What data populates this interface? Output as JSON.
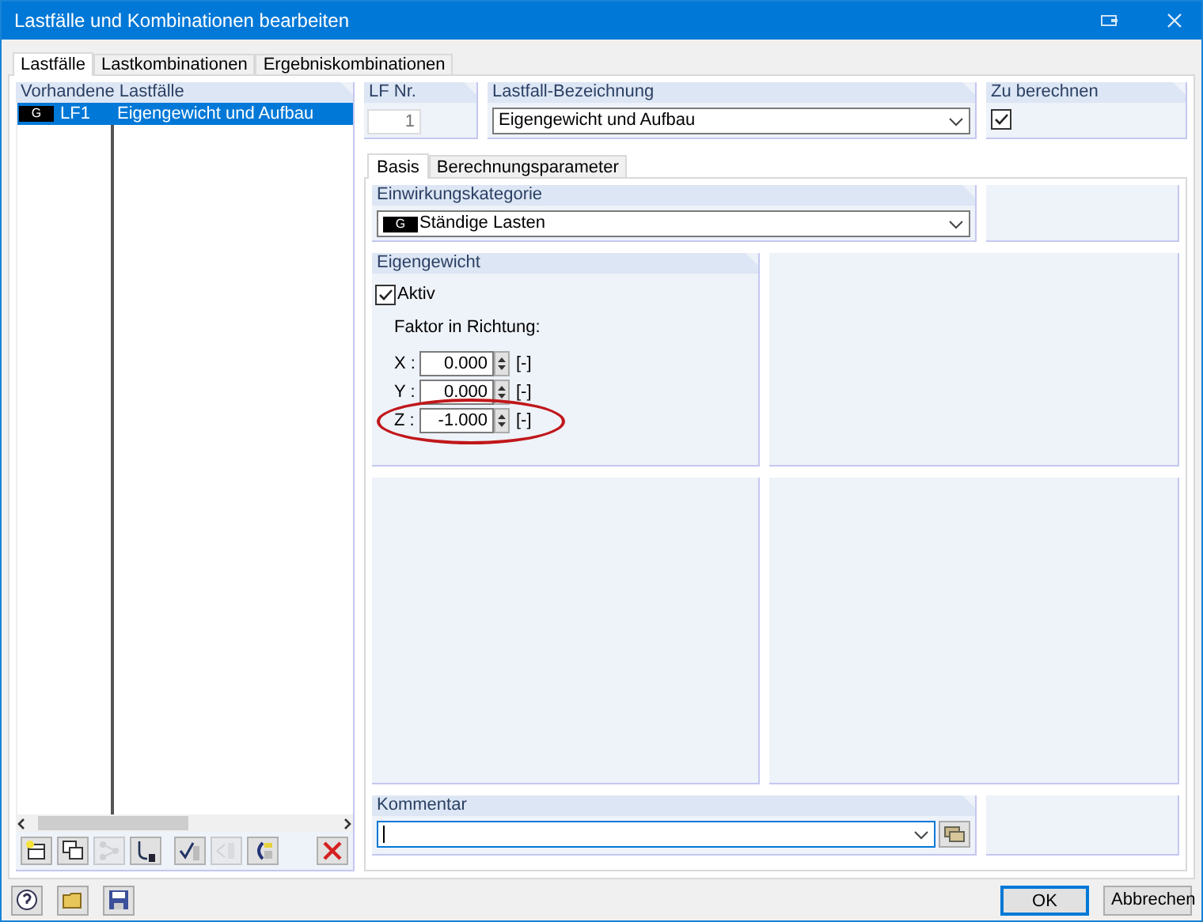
{
  "window": {
    "title": "Lastfälle und Kombinationen bearbeiten"
  },
  "tabs": [
    {
      "label": "Lastfälle",
      "selected": true
    },
    {
      "label": "Lastkombinationen",
      "selected": false
    },
    {
      "label": "Ergebniskombinationen",
      "selected": false
    }
  ],
  "load_cases": {
    "title": "Vorhandene Lastfälle",
    "rows": [
      {
        "badge": "G",
        "number": "LF1",
        "name": "Eigengewicht und Aufbau",
        "selected": true
      }
    ]
  },
  "toolbar": [
    {
      "kind": "new",
      "disabled": false
    },
    {
      "kind": "copy",
      "disabled": false
    },
    {
      "kind": "generate",
      "disabled": true
    },
    {
      "kind": "renumber",
      "disabled": false
    },
    {
      "kind": "check",
      "disabled": false
    },
    {
      "kind": "split",
      "disabled": true
    },
    {
      "kind": "import",
      "disabled": false
    },
    {
      "kind": "delete",
      "disabled": false
    }
  ],
  "lf_nr": {
    "label": "LF Nr.",
    "value": "1",
    "disabled": true
  },
  "designation": {
    "label": "Lastfall-Bezeichnung",
    "value": "Eigengewicht und Aufbau"
  },
  "to_calculate": {
    "label": "Zu berechnen",
    "checked": true
  },
  "subtabs": [
    {
      "label": "Basis",
      "selected": true
    },
    {
      "label": "Berechnungsparameter",
      "selected": false
    }
  ],
  "category": {
    "label": "Einwirkungskategorie",
    "badge": "G",
    "value": "Ständige Lasten"
  },
  "self_weight": {
    "label": "Eigengewicht",
    "active": {
      "label": "Aktiv",
      "checked": true
    },
    "factor_label": "Faktor in Richtung:",
    "factors": [
      {
        "axis": "X :",
        "value": "0.000",
        "unit": "[-]",
        "highlighted": false
      },
      {
        "axis": "Y :",
        "value": "0.000",
        "unit": "[-]",
        "highlighted": false
      },
      {
        "axis": "Z :",
        "value": "-1.000",
        "unit": "[-]",
        "highlighted": true
      }
    ]
  },
  "comment": {
    "label": "Kommentar"
  },
  "buttons": [
    {
      "label": "OK",
      "default": true
    },
    {
      "label": "Abbrechen",
      "default": false
    }
  ]
}
